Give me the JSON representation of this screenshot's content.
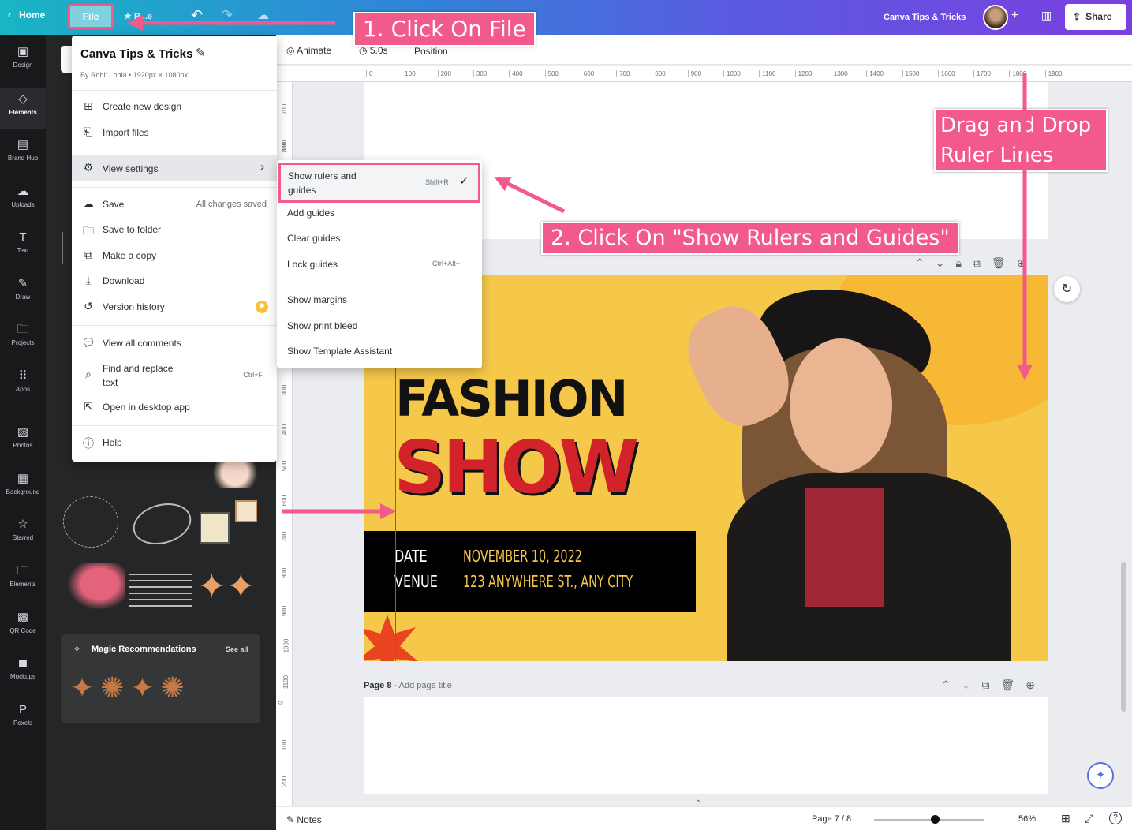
{
  "topbar": {
    "home": "Home",
    "file": "File",
    "resize": "Resize",
    "brand": "Canva Tips & Tricks",
    "share": "Share"
  },
  "rail": [
    {
      "label": "Design",
      "icon": "layout-icon"
    },
    {
      "label": "Elements",
      "icon": "shapes-icon"
    },
    {
      "label": "Brand Hub",
      "icon": "briefcase-icon"
    },
    {
      "label": "Uploads",
      "icon": "cloud-upload-icon"
    },
    {
      "label": "Text",
      "icon": "text-icon"
    },
    {
      "label": "Draw",
      "icon": "pen-icon"
    },
    {
      "label": "Projects",
      "icon": "folder-icon"
    },
    {
      "label": "Apps",
      "icon": "apps-icon"
    },
    {
      "label": "Photos",
      "icon": "image-icon"
    },
    {
      "label": "Background",
      "icon": "texture-icon"
    },
    {
      "label": "Starred",
      "icon": "star-icon"
    },
    {
      "label": "Elements",
      "icon": "folder-icon"
    },
    {
      "label": "QR Code",
      "icon": "qr-icon"
    },
    {
      "label": "Mockups",
      "icon": "mockups-icon"
    },
    {
      "label": "Pexels",
      "icon": "pexels-icon"
    }
  ],
  "panel": {
    "magic": "Magic Recommendations",
    "see_all": "See all"
  },
  "file_menu": {
    "title": "Canva Tips & Tricks",
    "meta": "By Rohit Lohia • 1920px × 1080px",
    "create": "Create new design",
    "import": "Import files",
    "view_settings": "View settings",
    "save": "Save",
    "saved": "All changes saved",
    "save_folder": "Save to folder",
    "copy": "Make a copy",
    "download": "Download",
    "version": "Version history",
    "comments": "View all comments",
    "find": "Find and replace",
    "find2": "text",
    "find_kbd": "Ctrl+F",
    "desktop": "Open in desktop app",
    "help": "Help"
  },
  "submenu": {
    "show_rulers": "Show rulers and",
    "show_rulers2": "guides",
    "show_rulers_kbd": "Shift+R",
    "add_guides": "Add guides",
    "clear_guides": "Clear guides",
    "lock_guides": "Lock guides",
    "lock_kbd": "Ctrl+Alt+;",
    "margins": "Show margins",
    "bleed": "Show print bleed",
    "template": "Show Template Assistant"
  },
  "toolbar": {
    "animate": "Animate",
    "duration": "5.0s",
    "position": "Position"
  },
  "ruler_h": [
    "0",
    "100",
    "200",
    "300",
    "400",
    "500",
    "600",
    "700",
    "800",
    "900",
    "1000",
    "1100",
    "1200",
    "1300",
    "1400",
    "1500",
    "1600",
    "1700",
    "1800",
    "1900"
  ],
  "ruler_v": [
    "700",
    "800",
    "900",
    "300",
    "400",
    "500",
    "600",
    "700",
    "800",
    "900",
    "1000",
    "1100",
    "0",
    "100",
    "200"
  ],
  "annotations": {
    "a1": "1. Click On File",
    "a2": "2. Click On \"Show Rulers and Guides\"",
    "a3a": "Drag and Drop",
    "a3b": "Ruler Lines"
  },
  "design": {
    "fashion": "FASHION",
    "show": "SHOW",
    "date_label": "DATE",
    "venue_label": "VENUE",
    "date_val": "NOVEMBER 10, 2022",
    "venue_val": "123 ANYWHERE ST., ANY CITY"
  },
  "page8": {
    "label": "Page 8",
    "title": "- Add page title"
  },
  "bottombar": {
    "notes": "Notes",
    "page": "Page 7 / 8",
    "zoom": "56%",
    "zoom_level": 0.56
  },
  "colors": {
    "accent": "#f15a8a",
    "poster_bg": "#f5c84a",
    "show_red": "#d2232a"
  }
}
